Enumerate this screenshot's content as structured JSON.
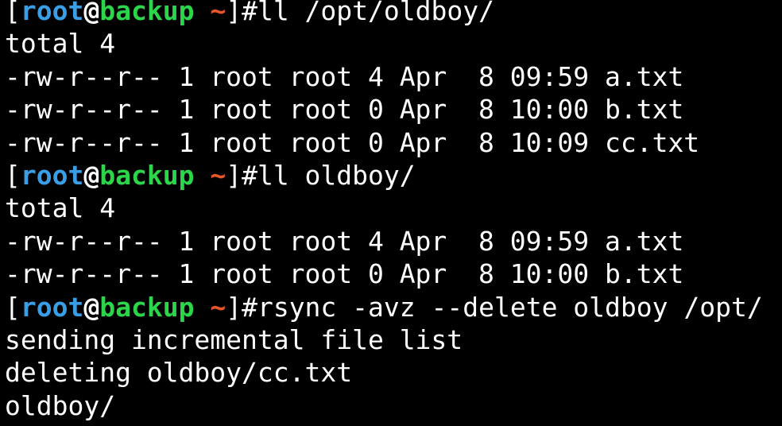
{
  "colors": {
    "background": "#000000",
    "text": "#ffffff",
    "user": "#3a9ee6",
    "host": "#2bd64a",
    "tilde": "#e8562a"
  },
  "prompt": {
    "open_bracket": "[",
    "user": "root",
    "at": "@",
    "host": "backup",
    "space": " ",
    "dir": "~",
    "close": "]#"
  },
  "lines": [
    {
      "kind": "prompt",
      "command": "ll /opt/oldboy/"
    },
    {
      "kind": "output",
      "text": "total 4"
    },
    {
      "kind": "output",
      "text": "-rw-r--r-- 1 root root 4 Apr  8 09:59 a.txt"
    },
    {
      "kind": "output",
      "text": "-rw-r--r-- 1 root root 0 Apr  8 10:00 b.txt"
    },
    {
      "kind": "output",
      "text": "-rw-r--r-- 1 root root 0 Apr  8 10:09 cc.txt"
    },
    {
      "kind": "prompt",
      "command": "ll oldboy/"
    },
    {
      "kind": "output",
      "text": "total 4"
    },
    {
      "kind": "output",
      "text": "-rw-r--r-- 1 root root 4 Apr  8 09:59 a.txt"
    },
    {
      "kind": "output",
      "text": "-rw-r--r-- 1 root root 0 Apr  8 10:00 b.txt"
    },
    {
      "kind": "prompt",
      "command": "rsync -avz --delete oldboy /opt/"
    },
    {
      "kind": "output",
      "text": "sending incremental file list"
    },
    {
      "kind": "output",
      "text": "deleting oldboy/cc.txt"
    },
    {
      "kind": "output",
      "text": "oldboy/"
    }
  ]
}
